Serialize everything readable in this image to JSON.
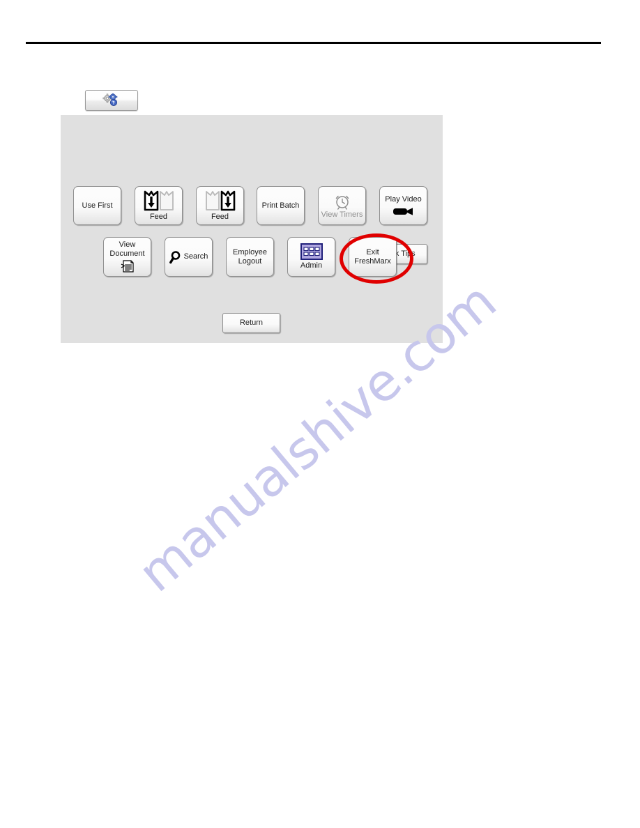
{
  "page": {
    "background_color": "#ffffff",
    "watermark_text": "manualshive.com",
    "watermark_color": "#c7c7ec"
  },
  "toolbar": {
    "tile_icon": "gears-help-icon",
    "tile_tooltip": ""
  },
  "panel": {
    "background_color": "#e0e0e0",
    "quick_tips": {
      "label": "Quick Tips"
    },
    "row1": [
      {
        "id": "use-first",
        "label": "Use First",
        "icon": null,
        "dim": false
      },
      {
        "id": "feed-left",
        "label": "Feed",
        "icon": "feed-left-icon",
        "dim": false
      },
      {
        "id": "feed-right",
        "label": "Feed",
        "icon": "feed-right-icon",
        "dim": false
      },
      {
        "id": "print-batch",
        "label": "Print Batch",
        "icon": null,
        "dim": false
      },
      {
        "id": "view-timers",
        "label": "View Timers",
        "icon": "alarm-clock-icon",
        "dim": true
      },
      {
        "id": "play-video",
        "label": "Play Video",
        "icon": "video-camera-icon",
        "dim": false
      }
    ],
    "row2": [
      {
        "id": "view-document",
        "label": "View\nDocument",
        "icon": "document-icon",
        "dim": false
      },
      {
        "id": "search",
        "label": "Search",
        "icon": "magnifier-icon",
        "dim": false
      },
      {
        "id": "employee-logout",
        "label": "Employee\nLogout",
        "icon": null,
        "dim": false
      },
      {
        "id": "admin",
        "label": "Admin",
        "icon": "keypad-icon",
        "dim": false
      },
      {
        "id": "exit-freshmarx",
        "label": "Exit\nFreshMarx",
        "icon": null,
        "dim": false
      }
    ],
    "return": {
      "label": "Return"
    }
  },
  "annotation": {
    "shape": "ellipse",
    "color": "#e00000",
    "targets": "exit-freshmarx"
  }
}
